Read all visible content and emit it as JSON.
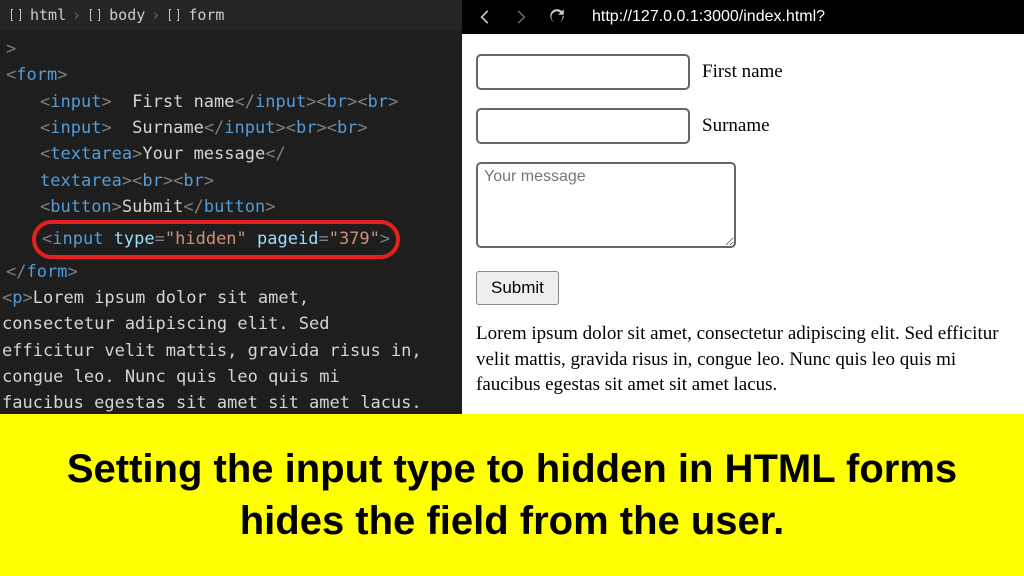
{
  "breadcrumb": {
    "item1": "html",
    "item2": "body",
    "item3": "form"
  },
  "code": {
    "line1_close": ">",
    "form_open": "form",
    "input_tag": "input",
    "first_name_text": "  First name",
    "surname_text": "  Surname",
    "br_tag": "br",
    "textarea_tag": "textarea",
    "textarea_content": "Your message",
    "button_tag": "button",
    "button_text": "Submit",
    "type_attr": "type",
    "type_val": "\"hidden\"",
    "pageid_attr": "pageid",
    "pageid_val": "\"379\"",
    "p_tag": "p",
    "lorem1": "Lorem ipsum dolor sit amet,",
    "lorem2": "consectetur adipiscing elit. Sed",
    "lorem3": "efficitur velit mattis, gravida risus in,",
    "lorem4": "congue leo. Nunc quis leo quis mi",
    "lorem5": "faucibus egestas sit amet sit amet lacus."
  },
  "browser": {
    "url": "http://127.0.0.1:3000/index.html?",
    "first_name_label": "First name",
    "surname_label": "Surname",
    "textarea_placeholder": "Your message",
    "submit_label": "Submit",
    "paragraph": "Lorem ipsum dolor sit amet, consectetur adipiscing elit. Sed efficitur velit mattis, gravida risus in, congue leo. Nunc quis leo quis mi faucibus egestas sit amet sit amet lacus."
  },
  "caption": "Setting the input type to hidden in HTML forms hides the field from the user."
}
